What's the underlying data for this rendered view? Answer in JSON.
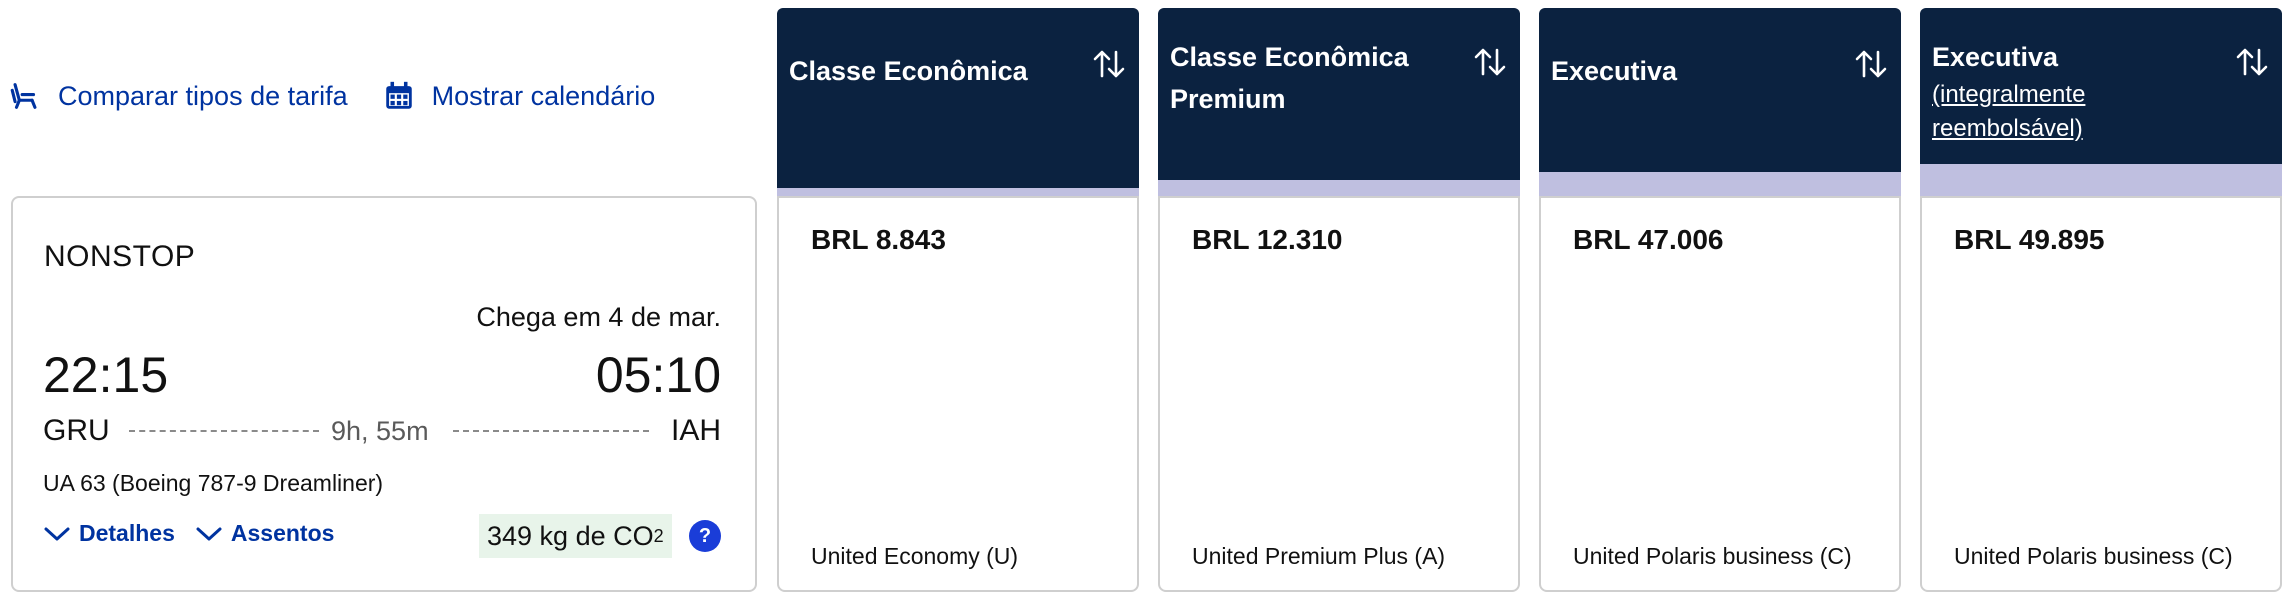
{
  "top_links": {
    "compare_label": "Comparar tipos de tarifa",
    "compare_icon": "seat-icon",
    "calendar_label": "Mostrar calendário",
    "calendar_icon": "calendar-icon",
    "color": "#0033a0"
  },
  "flight": {
    "nonstop": "NONSTOP",
    "arrives": "Chega em 4 de mar.",
    "departure_time": "22:15",
    "arrival_time": "05:10",
    "origin": "GRU",
    "destination": "IAH",
    "duration": "9h, 55m",
    "aircraft": "UA 63 (Boeing 787-9 Dreamliner)",
    "details_label": "Detalhes",
    "seats_label": "Assentos",
    "co2_value": "349 kg de CO",
    "co2_subscript": "2",
    "help_symbol": "?"
  },
  "fares": [
    {
      "title": "Classe Econômica",
      "title_line2": "",
      "price": "BRL 8.843",
      "cabin": "United Economy (U)"
    },
    {
      "title": "Classe Econômica",
      "title_line2": "Premium",
      "price": "BRL 12.310",
      "cabin": "United Premium Plus (A)"
    },
    {
      "title": "Executiva",
      "title_line2": "",
      "price": "BRL 47.006",
      "cabin": "United Polaris business (C)"
    },
    {
      "title": "Executiva",
      "subtitle_line1": "(integralmente",
      "subtitle_line2": "reembolsável)",
      "price": "BRL 49.895",
      "cabin": "United Polaris business (C)"
    }
  ],
  "colors": {
    "header_bg": "#0b2240",
    "band": "#bfbfe0",
    "co2_bg": "#e8f4ea",
    "help_bg": "#1a3dd8"
  }
}
